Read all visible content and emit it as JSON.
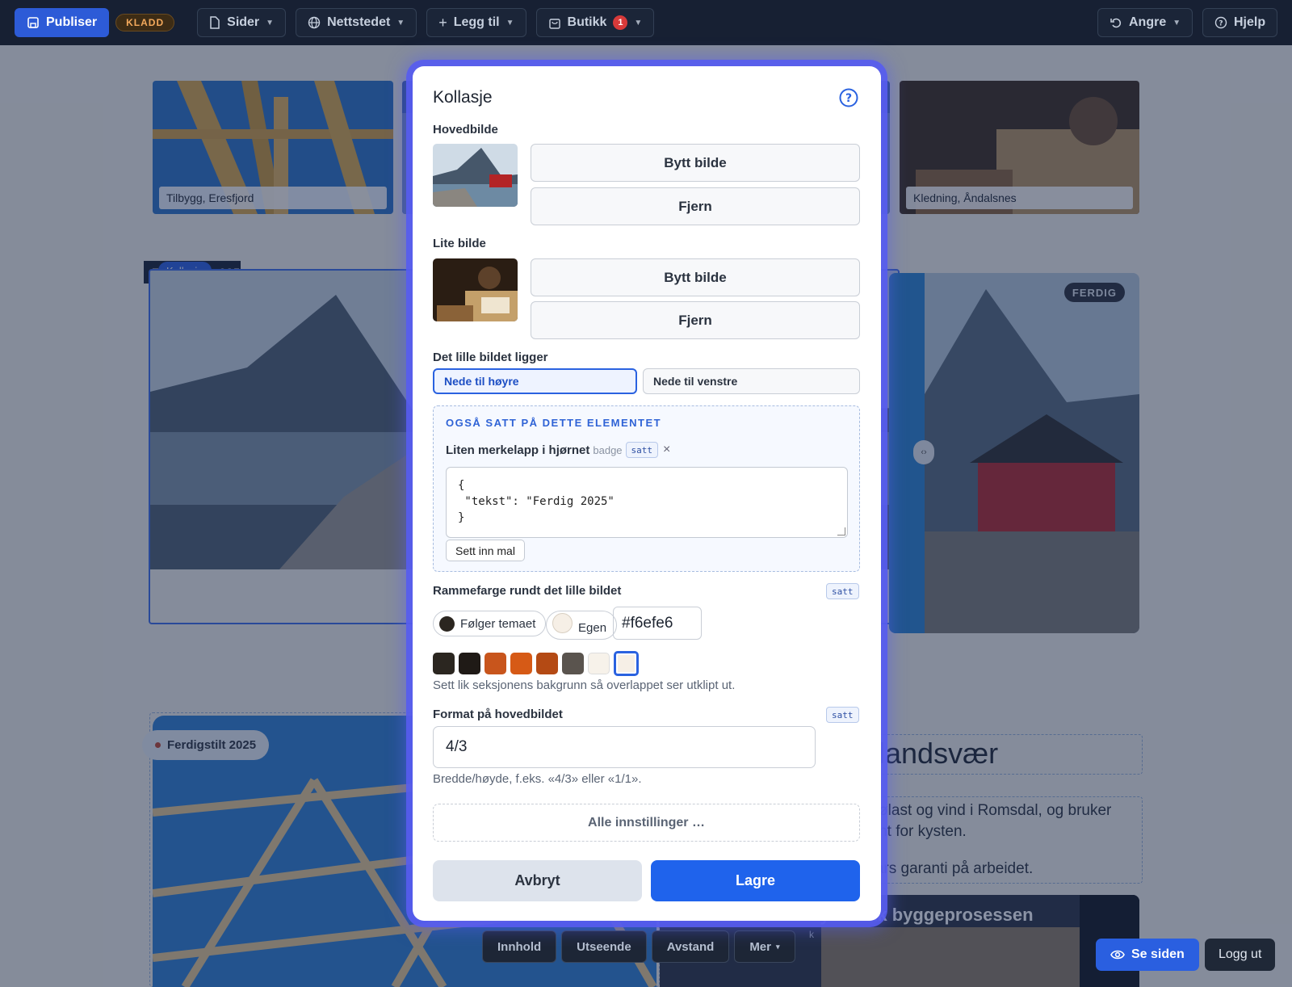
{
  "toolbar": {
    "publish": "Publiser",
    "draft_badge": "KLADD",
    "pages": "Sider",
    "website": "Nettstedet",
    "add": "Legg til",
    "shop": "Butikk",
    "shop_count": "1",
    "undo": "Angre",
    "help": "Hjelp"
  },
  "background": {
    "top_caption_left": "Tilbygg, Eresfjord",
    "top_caption_right": "Kledning, Åndalsnes",
    "section_label_prefix": "F",
    "section_label_suffix": "025",
    "kollasje_chip": "Kollasje",
    "ferdig_badge": "FERDIG",
    "ferdigstilt_badge": "Ferdigstilt 2025",
    "heading_fragment": "tlandsvær",
    "para_line1": "snølast og vind i Romsdal, og bruker",
    "para_line2": "tjent for kysten.",
    "para_line3": "n års garanti på arbeidet.",
    "story_title_fragment": "hytte fikk byggeprosessen",
    "story_sub_fragment": "k"
  },
  "bottom_tabs": [
    "Innhold",
    "Utseende",
    "Avstand",
    "Mer"
  ],
  "bottom_tabs_more_symbol": "▾",
  "view_site": "Se siden",
  "logout": "Logg ut",
  "modal": {
    "title": "Kollasje",
    "main_image_label": "Hovedbilde",
    "small_image_label": "Lite bilde",
    "replace_image": "Bytt bilde",
    "remove": "Fjern",
    "position_label": "Det lille bildet ligger",
    "position_options": [
      "Nede til høyre",
      "Nede til venstre"
    ],
    "position_selected": "Nede til høyre",
    "also_set_heading": "OGSÅ SATT PÅ DETTE ELEMENTET",
    "badge_field_label": "Liten merkelapp i hjørnet",
    "badge_field_key": "badge",
    "set_chip": "satt",
    "remove_symbol": "×",
    "badge_code": "{\n \"tekst\": \"Ferdig 2025\"\n}",
    "insert_template": "Sett inn mal",
    "frame_color_label": "Rammefarge rundt det lille bildet",
    "follows_theme": "Følger temaet",
    "custom": "Egen",
    "hex_value": "#f6efe6",
    "swatches": [
      "#2b2620",
      "#1f1a16",
      "#c8551c",
      "#d65a16",
      "#b44a14",
      "#5a544e",
      "#f7f2ea",
      "#f6efe6"
    ],
    "frame_hint": "Sett lik seksjonens bakgrunn så overlappet ser utklipt ut.",
    "format_label": "Format på hovedbildet",
    "format_value": "4/3",
    "format_hint": "Bredde/høyde, f.eks. «4/3» eller «1/1».",
    "all_settings": "Alle innstillinger …",
    "cancel": "Avbryt",
    "save": "Lagre"
  },
  "colors": {
    "accent": "#2a62e0",
    "topbar": "#172033",
    "modal_glow": "#5a5ff0"
  }
}
